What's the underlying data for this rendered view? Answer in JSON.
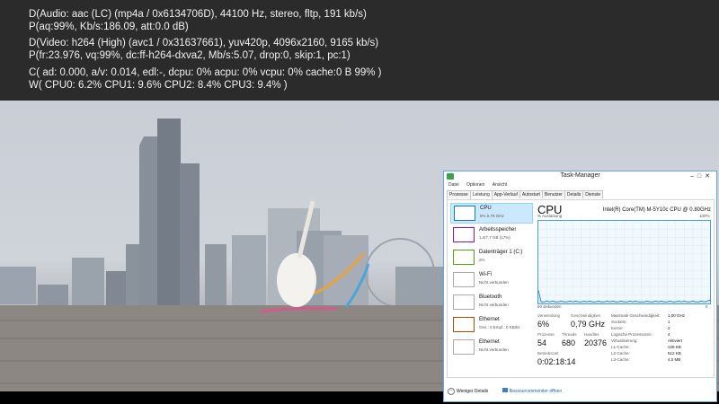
{
  "osd": {
    "audio_decoder": "D(Audio: aac (LC) (mp4a / 0x6134706D), 44100 Hz, stereo, fltp, 191 kb/s)",
    "audio_stats": "P(aq:99%, Kb/s:186.09, att:0.0 dB)",
    "video_decoder": "D(Video: h264 (High) (avc1 / 0x31637661), yuv420p, 4096x2160, 9165 kb/s)",
    "video_stats": "P(fr:23.976, vq:99%, dc:ff-h264-dxva2, Mb/s:5.07, drop:0, skip:1, pc:1)",
    "clock_stats": "C( ad: 0.000, a/v: 0.014, edl:-, dcpu: 0% acpu: 0% vcpu: 0% cache:0 B 99% )",
    "cpu_stats": "W( CPU0: 6.2% CPU1: 9.6% CPU2: 8.4% CPU3: 9.4% )"
  },
  "task_manager": {
    "title": "Task-Manager",
    "menu": [
      "Datei",
      "Optionen",
      "Ansicht"
    ],
    "tabs": [
      "Prozesse",
      "Leistung",
      "App-Verlauf",
      "Autostart",
      "Benutzer",
      "Details",
      "Dienste"
    ],
    "active_tab": "Leistung",
    "resources": [
      {
        "name": "CPU",
        "sub": "6% 0,79 GHz",
        "color": "#117dbb",
        "selected": true
      },
      {
        "name": "Arbeitsspeicher",
        "sub": "1,3/7,7 GB (17%)",
        "color": "#8b12ae"
      },
      {
        "name": "Datenträger 1 (C:)",
        "sub": "2%",
        "color": "#4da60c"
      },
      {
        "name": "Wi-Fi",
        "sub": "Nicht verbunden",
        "color": "#aaaaaa"
      },
      {
        "name": "Bluetooth",
        "sub": "Nicht verbunden",
        "color": "#aaaaaa"
      },
      {
        "name": "Ethernet",
        "sub": "Ges.: 0 Empf.: 0 KBit/s",
        "color": "#a74f01"
      },
      {
        "name": "Ethernet",
        "sub": "Nicht verbunden",
        "color": "#aaaaaa"
      }
    ],
    "cpu": {
      "heading": "CPU",
      "model": "Intel(R) Core(TM) M-5Y10c CPU @ 0.80GHz",
      "graph_ylabel": "% Auslastung",
      "graph_ymax": "100%",
      "graph_xlabel": "60 Sekunden",
      "graph_xmin": "0",
      "usage_history": [
        16,
        2,
        2,
        3,
        2,
        3,
        2,
        2,
        3,
        2,
        2,
        3,
        2,
        3,
        2,
        2,
        3,
        2,
        3,
        2,
        2,
        3,
        2,
        2,
        3,
        2,
        3,
        2,
        2,
        3,
        2,
        2,
        3,
        2,
        3,
        2,
        2,
        2,
        3,
        2,
        2,
        3,
        2,
        3,
        2,
        2,
        3,
        2,
        2,
        3,
        2,
        3,
        2,
        2,
        3,
        2,
        2,
        3,
        2,
        3,
        4
      ],
      "stats": {
        "usage_label": "Verwendung",
        "usage": "6%",
        "speed_label": "Geschwindigkeit",
        "speed": "0,79 GHz",
        "processes_label": "Prozesse",
        "processes": "54",
        "threads_label": "Threads",
        "threads": "680",
        "handles_label": "Handles",
        "handles": "20376",
        "uptime_label": "Betriebszeit",
        "uptime": "0:02:18:14"
      },
      "specs": [
        {
          "label": "Maximale Geschwindigkeit:",
          "value": "1,00 GHz"
        },
        {
          "label": "Sockets:",
          "value": "1"
        },
        {
          "label": "Kerne:",
          "value": "2"
        },
        {
          "label": "Logische Prozessoren:",
          "value": "4"
        },
        {
          "label": "Virtualisierung:",
          "value": "Aktiviert"
        },
        {
          "label": "L1-Cache:",
          "value": "128 KB"
        },
        {
          "label": "L2-Cache:",
          "value": "512 KB"
        },
        {
          "label": "L3-Cache:",
          "value": "4,0 MB"
        }
      ]
    },
    "footer": {
      "fewer_details": "Weniger Details",
      "resource_monitor": "Ressourcenmonitor öffnen"
    }
  }
}
